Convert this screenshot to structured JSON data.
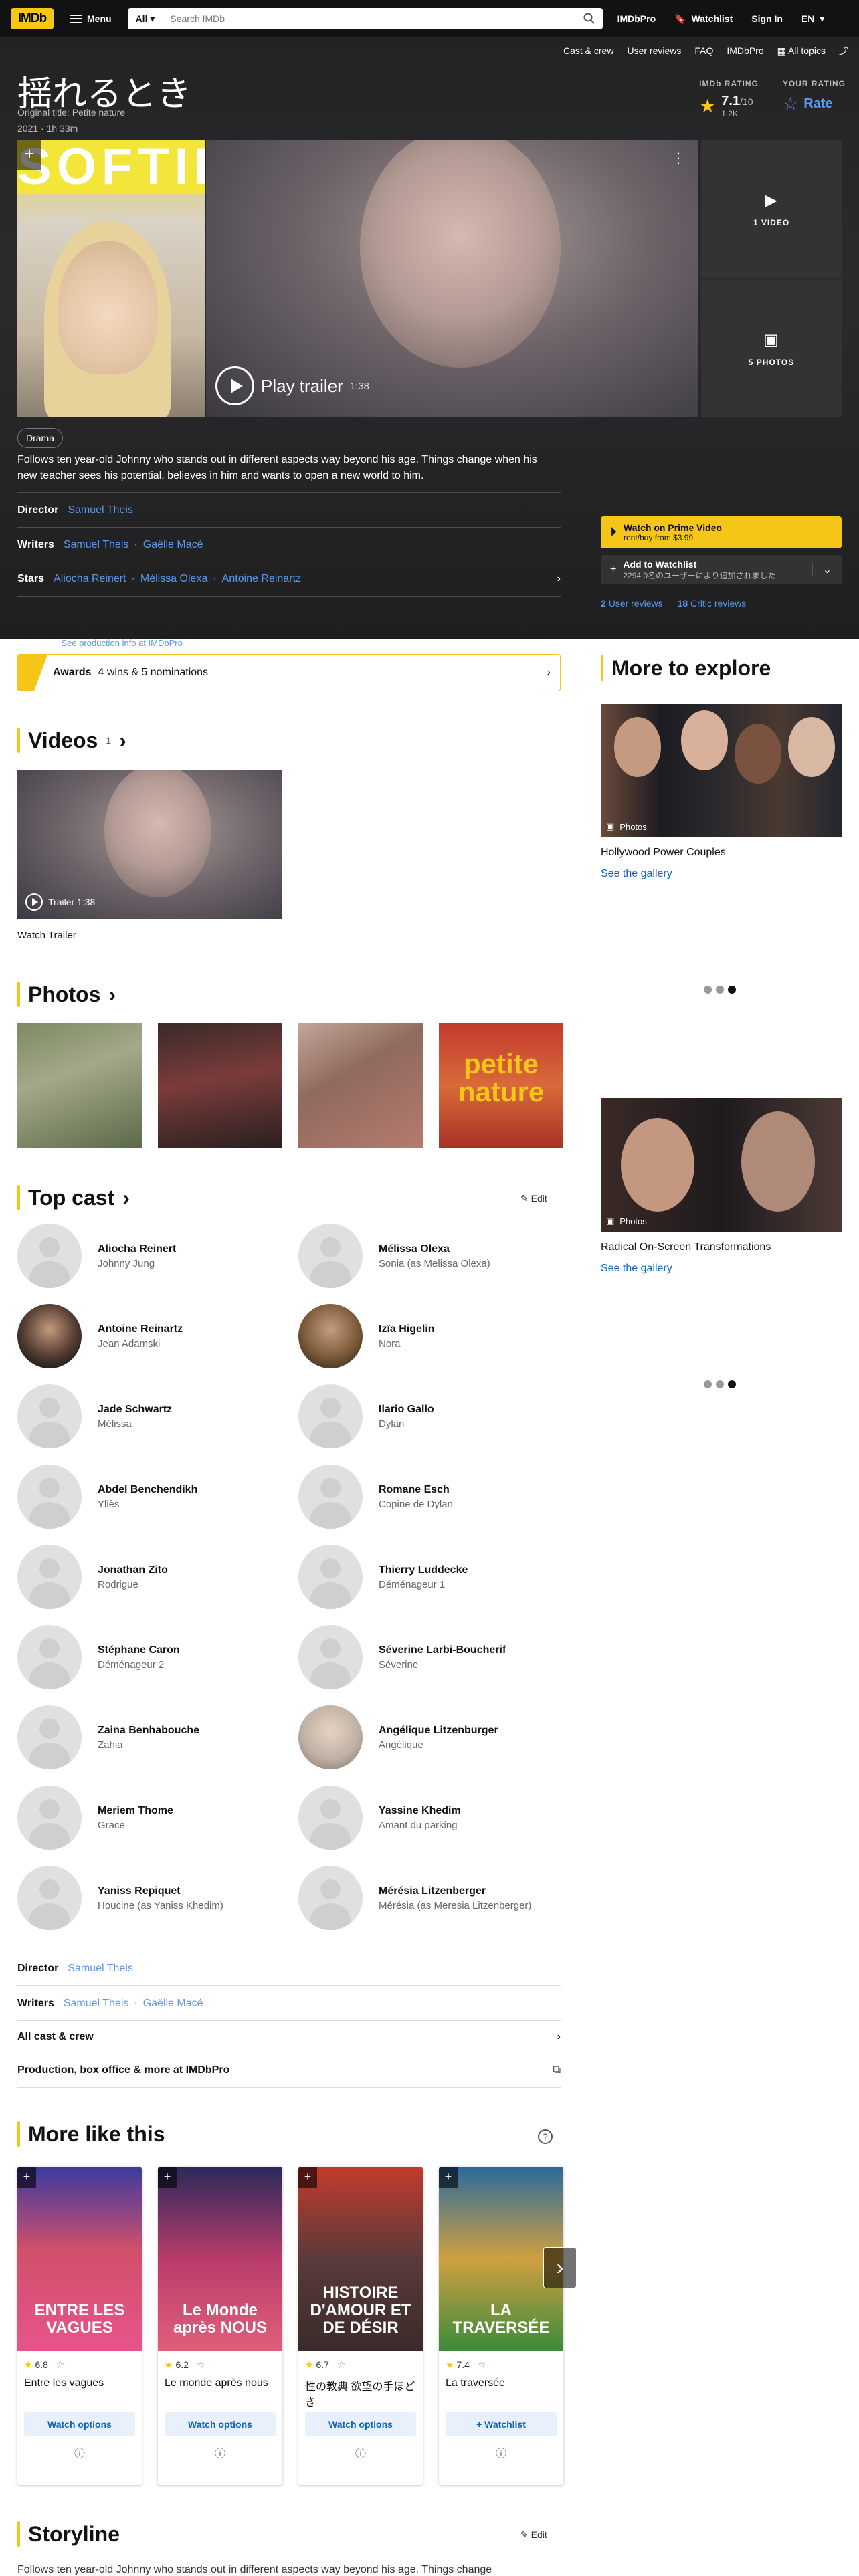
{
  "nav": {
    "logo": "IMDb",
    "menu": "Menu",
    "search_scope": "All",
    "search_placeholder": "Search IMDb",
    "pro": "IMDbPro",
    "watchlist": "Watchlist",
    "signin": "Sign In",
    "lang": "EN"
  },
  "hero": {
    "links": [
      "Cast & crew",
      "User reviews",
      "FAQ",
      "IMDbPro",
      "All topics"
    ],
    "title": "揺れるとき",
    "original_title": "Original title: Petite nature",
    "year": "2021",
    "runtime": "1h 33m",
    "imdb_rating_label": "IMDb RATING",
    "rating": "7.1",
    "rating_out_of": "/10",
    "votes": "1.2K",
    "your_rating_label": "YOUR RATING",
    "rate": "Rate",
    "play_trailer": "Play trailer",
    "trailer_length": "1:38",
    "videos": "1 VIDEO",
    "photos": "5 PHOTOS",
    "genre": "Drama",
    "plot": "Follows ten year-old Johnny who stands out in different aspects way beyond his age. Things change when his new teacher sees his potential, believes in him and wants to open a new world to him.",
    "director_label": "Director",
    "director": "Samuel Theis",
    "writers_label": "Writers",
    "writers": [
      "Samuel Theis",
      "Gaëlle Macé"
    ],
    "stars_label": "Stars",
    "stars": [
      "Aliocha Reinert",
      "Mélissa Olexa",
      "Antoine Reinartz"
    ],
    "prime_title": "Watch on Prime Video",
    "prime_sub": "rent/buy from $3.99",
    "add_wl": "Add to Watchlist",
    "add_wl_sub": "2294.0名のユーザーにより追加されました",
    "user_reviews_count": "2",
    "user_reviews": "User reviews",
    "critic_reviews_count": "18",
    "critic_reviews": "Critic reviews",
    "pro_logo": "IMDbPro",
    "pro_link": "See production info at IMDbPro"
  },
  "awards": {
    "label": "Awards",
    "text": "4 wins & 5 nominations"
  },
  "videos": {
    "title": "Videos",
    "count": "1",
    "thumb_label": "Trailer 1:38",
    "caption": "Watch Trailer"
  },
  "photos": {
    "title": "Photos",
    "poster_text": "petite nature"
  },
  "cast": {
    "title": "Top cast",
    "edit": "Edit",
    "items": [
      {
        "name": "Aliocha Reinert",
        "role": "Johnny Jung"
      },
      {
        "name": "Mélissa Olexa",
        "role": "Sonia (as Melissa Olexa)"
      },
      {
        "name": "Antoine Reinartz",
        "role": "Jean Adamski"
      },
      {
        "name": "Izïa Higelin",
        "role": "Nora"
      },
      {
        "name": "Jade Schwartz",
        "role": "Mélissa"
      },
      {
        "name": "Ilario Gallo",
        "role": "Dylan"
      },
      {
        "name": "Abdel Benchendikh",
        "role": "Yliès"
      },
      {
        "name": "Romane Esch",
        "role": "Copine de Dylan"
      },
      {
        "name": "Jonathan Zito",
        "role": "Rodrigue"
      },
      {
        "name": "Thierry Luddecke",
        "role": "Déménageur 1"
      },
      {
        "name": "Stéphane Caron",
        "role": "Déménageur 2"
      },
      {
        "name": "Séverine Larbi-Boucherif",
        "role": "Séverine"
      },
      {
        "name": "Zaina Benhabouche",
        "role": "Zahia"
      },
      {
        "name": "Angélique Litzenburger",
        "role": "Angélique"
      },
      {
        "name": "Meriem Thome",
        "role": "Grace"
      },
      {
        "name": "Yassine Khedim",
        "role": "Amant du parking"
      },
      {
        "name": "Yaniss Repiquet",
        "role": "Houcine (as Yaniss Khedim)"
      },
      {
        "name": "Mérésia Litzenberger",
        "role": "Mérésia (as Meresia Litzenberger)"
      }
    ],
    "director_label": "Director",
    "director": "Samuel Theis",
    "writers_label": "Writers",
    "writers": [
      "Samuel Theis",
      "Gaëlle Macé"
    ],
    "all_cast": "All cast & crew",
    "production": "Production, box office & more at IMDbPro"
  },
  "more_like": {
    "title": "More like this",
    "items": [
      {
        "title": "Entre les vagues",
        "rating": "6.8",
        "button": "Watch options",
        "poster_text": "ENTRE LES VAGUES"
      },
      {
        "title": "Le monde après nous",
        "rating": "6.2",
        "button": "Watch options",
        "poster_text": "Le Monde après NOUS"
      },
      {
        "title": "性の教典 欲望の手ほどき",
        "rating": "6.7",
        "button": "Watch options",
        "poster_text": "HISTOIRE D'AMOUR ET DE DÉSIR"
      },
      {
        "title": "La traversée",
        "rating": "7.4",
        "button": "Watchlist",
        "poster_text": "LA TRAVERSÉE"
      }
    ]
  },
  "storyline": {
    "title": "Storyline",
    "edit": "Edit",
    "text": "Follows ten year-old Johnny who stands out in different aspects way beyond his age. Things change"
  },
  "explore": {
    "title": "More to explore",
    "items": [
      {
        "label": "Photos",
        "caption": "Hollywood Power Couples",
        "link": "See the gallery"
      },
      {
        "label": "Photos",
        "caption": "Radical On-Screen Transformations",
        "link": "See the gallery"
      }
    ]
  }
}
